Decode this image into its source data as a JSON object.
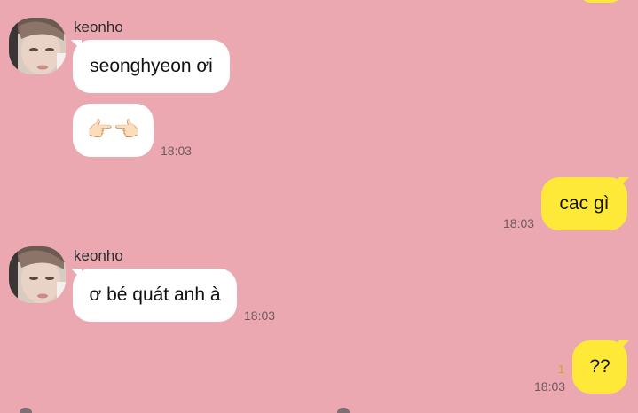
{
  "messages": [
    {
      "sender": "keonho",
      "bubbles": [
        {
          "text": "seonghyeon ơi"
        },
        {
          "text": "👉🏻👈🏻",
          "time": "18:03"
        }
      ]
    },
    {
      "sender": "me",
      "bubbles": [
        {
          "text": "cac gì",
          "time": "18:03"
        }
      ]
    },
    {
      "sender": "keonho",
      "bubbles": [
        {
          "text": "ơ bé quát anh à",
          "time": "18:03"
        }
      ]
    },
    {
      "sender": "me",
      "bubbles": [
        {
          "text": "??",
          "time": "18:03",
          "unread": "1"
        }
      ]
    }
  ],
  "colors": {
    "background": "#eca8b1",
    "incoming_bubble": "#ffffff",
    "outgoing_bubble": "#fee838"
  }
}
